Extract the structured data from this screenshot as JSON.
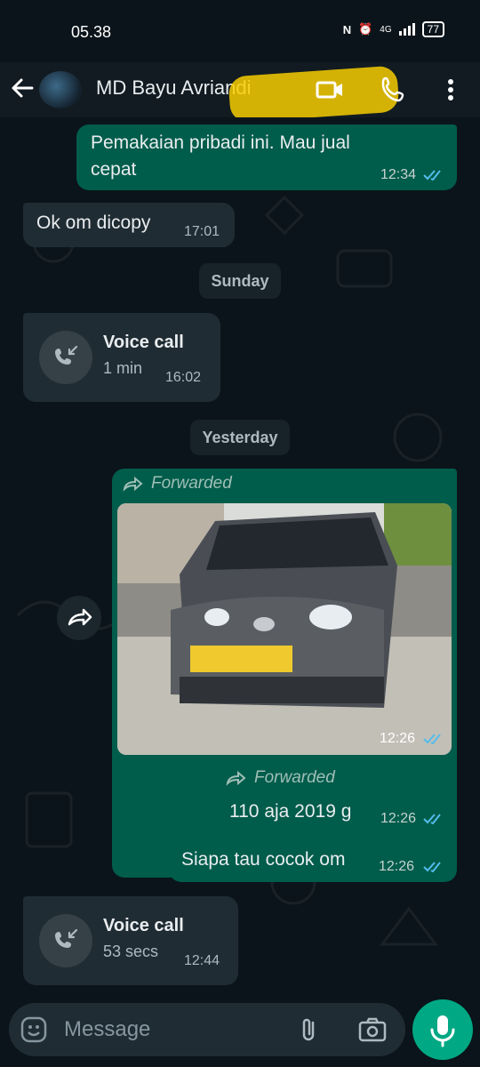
{
  "status_bar": {
    "time": "05.38",
    "network": "4G",
    "battery": "77"
  },
  "header": {
    "contact_name": "MD Bayu Avriandi"
  },
  "dates": {
    "sunday": "Sunday",
    "yesterday": "Yesterday"
  },
  "messages": [
    {
      "text": "Pemakaian pribadi ini. Mau jual cepat",
      "time": "12:34"
    },
    {
      "text": "Ok om dicopy",
      "time": "17:01"
    },
    {
      "title": "Voice call",
      "duration": "1 min",
      "time": "16:02"
    },
    {
      "forwarded": "Forwarded",
      "time": "12:26"
    },
    {
      "forwarded": "Forwarded",
      "text": "110 aja 2019 g",
      "time": "12:26"
    },
    {
      "text": "Siapa tau cocok om",
      "time": "12:26"
    },
    {
      "title": "Voice call",
      "duration": "53 secs",
      "time": "12:44"
    }
  ],
  "composer": {
    "placeholder": "Message"
  },
  "colors": {
    "outgoing": "#005c4b",
    "incoming": "#202c33",
    "accent": "#00a884",
    "read_ticks": "#53bdeb"
  },
  "icons": [
    "back-arrow-icon",
    "video-call-icon",
    "phone-icon",
    "more-vert-icon",
    "incoming-call-icon",
    "forward-icon",
    "emoji-icon",
    "attach-icon",
    "camera-icon",
    "mic-icon"
  ]
}
